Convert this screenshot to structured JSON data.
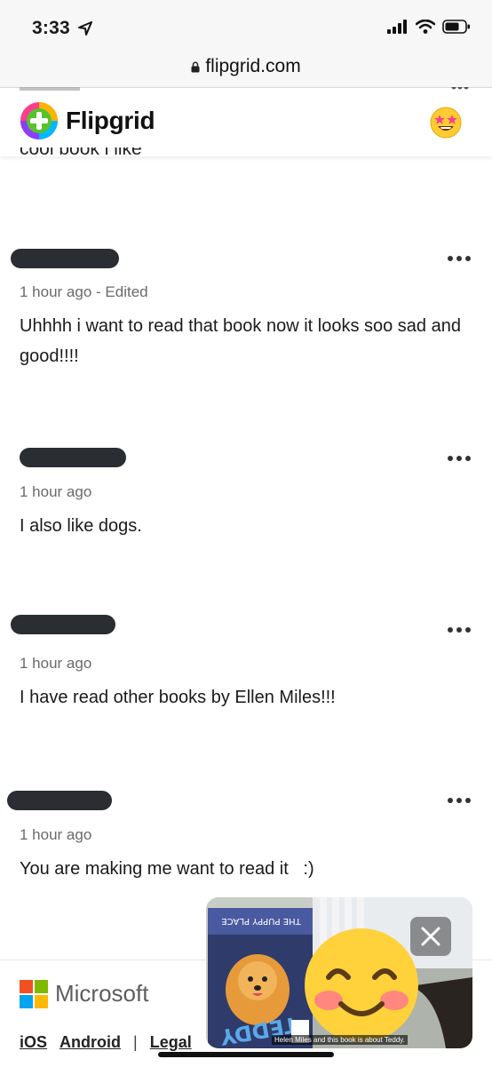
{
  "status_bar": {
    "time": "3:33"
  },
  "address_bar": {
    "url": "flipgrid.com"
  },
  "header": {
    "brand": "Flipgrid",
    "partial_text": "cool book i like"
  },
  "comments": [
    {
      "time": "1 hour ago - Edited",
      "text": "Uhhhh i want to read that book now it looks soo sad and good!!!!"
    },
    {
      "time": "1 hour ago",
      "text": "I also like dogs."
    },
    {
      "time": "1 hour ago",
      "text": "I have read other books by Ellen Miles!!!"
    },
    {
      "time": "1 hour ago",
      "text": "You are making me want to read it   :)"
    }
  ],
  "footer": {
    "company": "Microsoft",
    "links": {
      "ios": "iOS",
      "android": "Android",
      "separator": "|",
      "legal": "Legal"
    }
  },
  "video": {
    "caption": "Helen Miles and this book is about Teddy.",
    "book_title": "TEDDY",
    "book_series": "THE PUPPY PLACE"
  },
  "colors": {
    "brand_green": "#57c22e",
    "redaction": "#2a2e33",
    "timestamp": "#6a6a6a"
  },
  "icons": [
    "location-arrow-icon",
    "signal-icon",
    "wifi-icon",
    "battery-icon",
    "lock-icon",
    "flipgrid-logo-icon",
    "star-struck-emoji-icon",
    "more-options-icon",
    "microsoft-logo-icon",
    "close-icon",
    "smiling-emoji-icon"
  ]
}
